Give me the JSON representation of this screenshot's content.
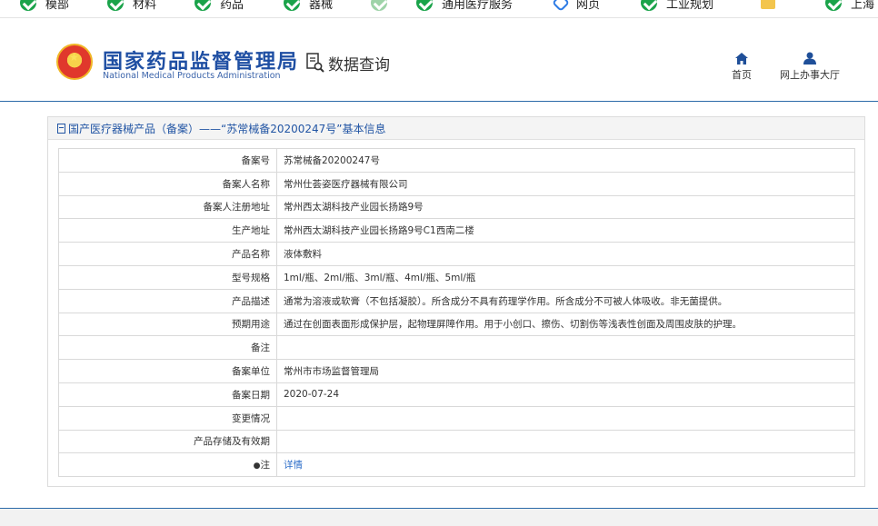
{
  "bookmarks": [
    {
      "label": "模部",
      "icon": "green-check-icon"
    },
    {
      "label": "材料",
      "icon": "green-check-icon"
    },
    {
      "label": "药品",
      "icon": "green-check-icon"
    },
    {
      "label": "器械",
      "icon": "green-check-icon"
    },
    {
      "label": "",
      "icon": "pale-check-icon"
    },
    {
      "label": "通用医疗服务",
      "icon": "green-check-icon"
    },
    {
      "label": "网页",
      "icon": "blue-diamond-icon"
    },
    {
      "label": "工业规划",
      "icon": "green-check-icon"
    },
    {
      "label": "",
      "icon": "folder-icon"
    },
    {
      "label": "上海",
      "icon": "green-check-icon"
    }
  ],
  "header": {
    "brand_cn": "国家药品监督管理局",
    "brand_en": "National Medical Products Administration",
    "page_label": "数据查询",
    "nav": {
      "home": "首页",
      "hall": "网上办事大厅"
    }
  },
  "panel": {
    "title": "国产医疗器械产品（备案）——“苏常械备20200247号”基本信息"
  },
  "rows": [
    {
      "k": "备案号",
      "v": "苏常械备20200247号"
    },
    {
      "k": "备案人名称",
      "v": "常州仕荟姿医疗器械有限公司"
    },
    {
      "k": "备案人注册地址",
      "v": "常州西太湖科技产业园长扬路9号"
    },
    {
      "k": "生产地址",
      "v": "常州西太湖科技产业园长扬路9号C1西南二楼"
    },
    {
      "k": "产品名称",
      "v": "液体敷料"
    },
    {
      "k": "型号规格",
      "v": "1ml/瓶、2ml/瓶、3ml/瓶、4ml/瓶、5ml/瓶"
    },
    {
      "k": "产品描述",
      "v": "通常为溶液或软膏（不包括凝胶）。所含成分不具有药理学作用。所含成分不可被人体吸收。非无菌提供。"
    },
    {
      "k": "预期用途",
      "v": "通过在创面表面形成保护层，起物理屏障作用。用于小创口、擦伤、切割伤等浅表性创面及周围皮肤的护理。"
    },
    {
      "k": "备注",
      "v": ""
    },
    {
      "k": "备案单位",
      "v": "常州市市场监督管理局"
    },
    {
      "k": "备案日期",
      "v": "2020-07-24"
    },
    {
      "k": "变更情况",
      "v": ""
    },
    {
      "k": "产品存储及有效期",
      "v": ""
    }
  ],
  "note": {
    "label": "注",
    "link": "详情"
  },
  "colors": {
    "brand_blue": "#1f4fa3",
    "link_blue": "#2d6ec9",
    "header_rule": "#2b6aa8"
  }
}
